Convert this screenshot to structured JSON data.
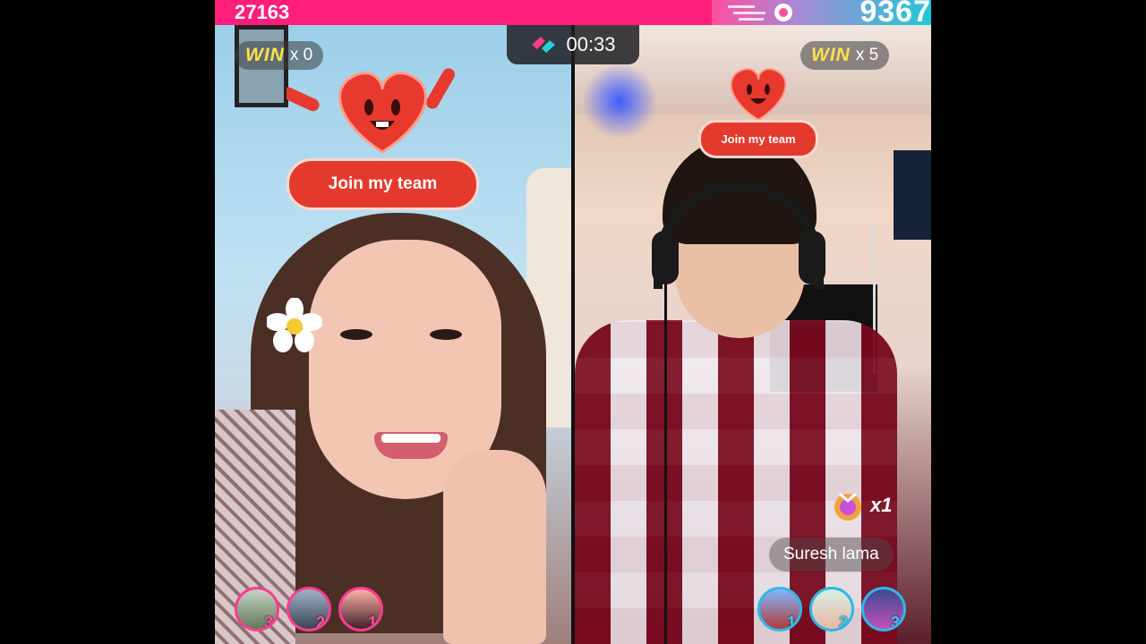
{
  "scores": {
    "left": "27163",
    "right": "9367"
  },
  "timer": {
    "value": "00:33"
  },
  "win_badges": {
    "left": {
      "label": "WIN",
      "count": "x 0"
    },
    "right": {
      "label": "WIN",
      "count": "x 5"
    }
  },
  "stickers": {
    "left": {
      "text": "Join my team"
    },
    "right": {
      "text": "Join my team"
    }
  },
  "gift": {
    "multiplier": "x1"
  },
  "streamer_name": "Suresh lama",
  "supporters": {
    "left": [
      {
        "rank": "3"
      },
      {
        "rank": "2"
      },
      {
        "rank": "1"
      }
    ],
    "right": [
      {
        "rank": "1"
      },
      {
        "rank": "2"
      },
      {
        "rank": "3"
      }
    ]
  },
  "colors": {
    "left_team": "#ff1f7a",
    "right_team": "#20c7d6",
    "win_text": "#ffe14a",
    "sticker_red": "#e43a2e"
  }
}
